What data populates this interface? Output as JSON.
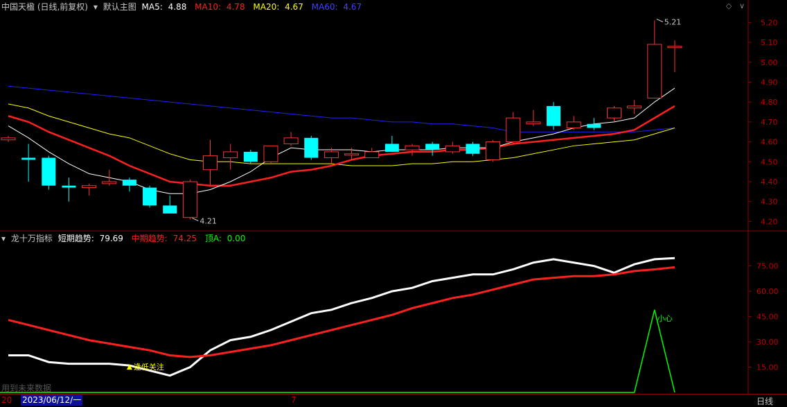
{
  "main_header": {
    "stock": "中国天楹 (日线,前复权)",
    "template": "默认主图",
    "ma5": {
      "label": "MA5:",
      "value": "4.88",
      "color": "#ffffff"
    },
    "ma10": {
      "label": "MA10:",
      "value": "4.78",
      "color": "#ff2020"
    },
    "ma20": {
      "label": "MA20:",
      "value": "4.67",
      "color": "#ffff00"
    },
    "ma60": {
      "label": "MA60:",
      "value": "4.67",
      "color": "#2020ff"
    }
  },
  "sub_header": {
    "indicator": "龙十万指标",
    "short": {
      "label": "短期趋势:",
      "value": "79.69",
      "color": "#ffffff"
    },
    "mid": {
      "label": "中期趋势:",
      "value": "74.25",
      "color": "#ff2020"
    },
    "top": {
      "label": "顶A:",
      "value": "0.00",
      "color": "#00ff00"
    }
  },
  "bottom_bar": {
    "year_clip": "20",
    "date": "2023/06/12/一",
    "month_mark": "7",
    "period": "日线",
    "watermark": "用到未来数据"
  },
  "chart_data": [
    {
      "type": "candlestick",
      "y_ticks": [
        "5.20",
        "5.10",
        "5.00",
        "4.90",
        "4.80",
        "4.70",
        "4.60",
        "4.50",
        "4.40",
        "4.30",
        "4.20"
      ],
      "ylim": [
        4.17,
        5.25
      ],
      "annotations": [
        {
          "text": "5.21",
          "value": 5.21
        },
        {
          "text": "4.21",
          "value": 4.21
        }
      ],
      "candles": [
        {
          "o": 4.61,
          "c": 4.62,
          "h": 4.63,
          "l": 4.6
        },
        {
          "o": 4.52,
          "c": 4.51,
          "h": 4.59,
          "l": 4.4
        },
        {
          "o": 4.52,
          "c": 4.38,
          "h": 4.53,
          "l": 4.36
        },
        {
          "o": 4.38,
          "c": 4.37,
          "h": 4.42,
          "l": 4.3
        },
        {
          "o": 4.37,
          "c": 4.38,
          "h": 4.39,
          "l": 4.33
        },
        {
          "o": 4.39,
          "c": 4.4,
          "h": 4.46,
          "l": 4.38
        },
        {
          "o": 4.41,
          "c": 4.38,
          "h": 4.42,
          "l": 4.35
        },
        {
          "o": 4.37,
          "c": 4.28,
          "h": 4.38,
          "l": 4.27
        },
        {
          "o": 4.28,
          "c": 4.24,
          "h": 4.33,
          "l": 4.24
        },
        {
          "o": 4.22,
          "c": 4.4,
          "h": 4.41,
          "l": 4.21
        },
        {
          "o": 4.46,
          "c": 4.53,
          "h": 4.61,
          "l": 4.38
        },
        {
          "o": 4.52,
          "c": 4.55,
          "h": 4.59,
          "l": 4.46
        },
        {
          "o": 4.55,
          "c": 4.5,
          "h": 4.56,
          "l": 4.49
        },
        {
          "o": 4.5,
          "c": 4.58,
          "h": 4.58,
          "l": 4.49
        },
        {
          "o": 4.59,
          "c": 4.62,
          "h": 4.65,
          "l": 4.58
        },
        {
          "o": 4.62,
          "c": 4.52,
          "h": 4.63,
          "l": 4.51
        },
        {
          "o": 4.52,
          "c": 4.55,
          "h": 4.57,
          "l": 4.49
        },
        {
          "o": 4.54,
          "c": 4.54,
          "h": 4.57,
          "l": 4.51
        },
        {
          "o": 4.52,
          "c": 4.55,
          "h": 4.57,
          "l": 4.52
        },
        {
          "o": 4.59,
          "c": 4.55,
          "h": 4.63,
          "l": 4.55
        },
        {
          "o": 4.56,
          "c": 4.58,
          "h": 4.59,
          "l": 4.53
        },
        {
          "o": 4.59,
          "c": 4.56,
          "h": 4.6,
          "l": 4.53
        },
        {
          "o": 4.55,
          "c": 4.58,
          "h": 4.6,
          "l": 4.54
        },
        {
          "o": 4.59,
          "c": 4.54,
          "h": 4.6,
          "l": 4.53
        },
        {
          "o": 4.51,
          "c": 4.6,
          "h": 4.61,
          "l": 4.5
        },
        {
          "o": 4.6,
          "c": 4.72,
          "h": 4.75,
          "l": 4.59
        },
        {
          "o": 4.69,
          "c": 4.7,
          "h": 4.76,
          "l": 4.68
        },
        {
          "o": 4.78,
          "c": 4.68,
          "h": 4.8,
          "l": 4.66
        },
        {
          "o": 4.67,
          "c": 4.7,
          "h": 4.73,
          "l": 4.66
        },
        {
          "o": 4.69,
          "c": 4.67,
          "h": 4.72,
          "l": 4.66
        },
        {
          "o": 4.72,
          "c": 4.77,
          "h": 4.78,
          "l": 4.7
        },
        {
          "o": 4.77,
          "c": 4.78,
          "h": 4.81,
          "l": 4.74
        },
        {
          "o": 4.82,
          "c": 5.09,
          "h": 5.21,
          "l": 4.82
        },
        {
          "o": 5.08,
          "c": 5.08,
          "h": 5.11,
          "l": 4.95
        }
      ],
      "ma5": [
        4.68,
        4.62,
        4.55,
        4.49,
        4.44,
        4.42,
        4.4,
        4.36,
        4.34,
        4.34,
        4.36,
        4.4,
        4.45,
        4.52,
        4.57,
        4.56,
        4.56,
        4.56,
        4.55,
        4.56,
        4.56,
        4.56,
        4.57,
        4.57,
        4.57,
        4.6,
        4.62,
        4.64,
        4.67,
        4.69,
        4.7,
        4.72,
        4.8,
        4.87
      ],
      "ma10": [
        4.73,
        4.7,
        4.65,
        4.61,
        4.57,
        4.53,
        4.48,
        4.44,
        4.4,
        4.39,
        4.38,
        4.38,
        4.4,
        4.42,
        4.45,
        4.46,
        4.48,
        4.51,
        4.53,
        4.54,
        4.55,
        4.55,
        4.56,
        4.56,
        4.57,
        4.59,
        4.6,
        4.61,
        4.62,
        4.63,
        4.64,
        4.66,
        4.72,
        4.78
      ],
      "ma20": [
        4.79,
        4.77,
        4.73,
        4.7,
        4.67,
        4.64,
        4.62,
        4.58,
        4.54,
        4.51,
        4.5,
        4.5,
        4.49,
        4.49,
        4.49,
        4.49,
        4.49,
        4.48,
        4.48,
        4.48,
        4.49,
        4.49,
        4.5,
        4.5,
        4.51,
        4.52,
        4.54,
        4.56,
        4.58,
        4.59,
        4.6,
        4.61,
        4.64,
        4.67
      ],
      "ma60": [
        4.88,
        4.87,
        4.86,
        4.85,
        4.84,
        4.83,
        4.82,
        4.81,
        4.8,
        4.79,
        4.78,
        4.77,
        4.76,
        4.75,
        4.74,
        4.73,
        4.72,
        4.72,
        4.71,
        4.7,
        4.7,
        4.69,
        4.69,
        4.68,
        4.67,
        4.65,
        4.65,
        4.65,
        4.65,
        4.65,
        4.65,
        4.65,
        4.66,
        4.67
      ]
    },
    {
      "type": "line",
      "y_ticks": [
        "75.00",
        "60.00",
        "45.00",
        "30.00",
        "15.00"
      ],
      "ylim": [
        0,
        88
      ],
      "series": [
        {
          "name": "短期趋势",
          "color": "#ffffff",
          "values": [
            22,
            22,
            18,
            17,
            17,
            17,
            16,
            13,
            10,
            15,
            25,
            31,
            33,
            37,
            42,
            47,
            49,
            53,
            56,
            60,
            62,
            66,
            68,
            70,
            70,
            73,
            77,
            79,
            77,
            75,
            71,
            76,
            79,
            79.69
          ]
        },
        {
          "name": "中期趋势",
          "color": "#ff2020",
          "values": [
            43,
            40,
            37,
            34,
            31,
            29,
            27,
            25,
            22,
            21,
            22,
            24,
            26,
            28,
            31,
            34,
            37,
            40,
            43,
            46,
            50,
            53,
            56,
            58,
            61,
            64,
            67,
            68,
            69,
            69,
            70,
            72,
            73,
            74.25
          ]
        },
        {
          "name": "顶A",
          "color": "#00ff00",
          "values": [
            0,
            0,
            0,
            0,
            0,
            0,
            0,
            0,
            0,
            0,
            0,
            0,
            0,
            0,
            0,
            0,
            0,
            0,
            0,
            0,
            0,
            0,
            0,
            0,
            0,
            0,
            0,
            0,
            0,
            0,
            0,
            0,
            49,
            0
          ]
        }
      ],
      "annotations": [
        {
          "text": "逢低关注",
          "color": "#ffff00",
          "index": 6,
          "value": 16
        },
        {
          "text": "小心",
          "color": "#00ff00",
          "index": 32,
          "value": 49
        }
      ]
    }
  ]
}
